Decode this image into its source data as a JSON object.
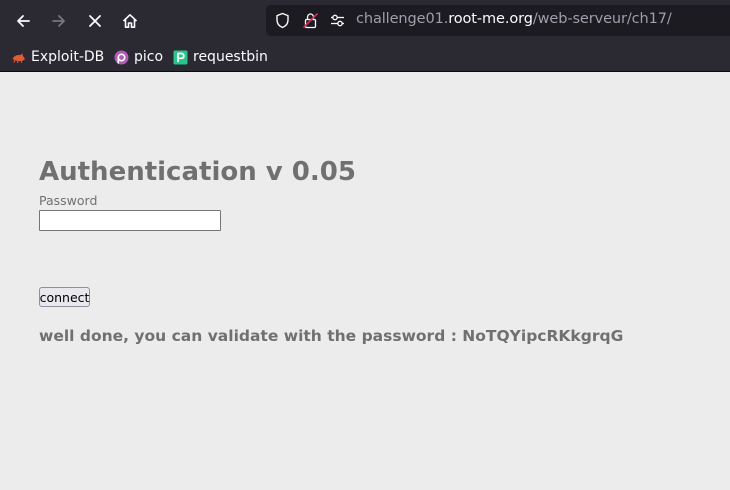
{
  "browser": {
    "url_prefix": "challenge01.",
    "url_domain": "root-me.org",
    "url_path": "/web-serveur/ch17/",
    "icons": [
      "back-arrow-icon",
      "forward-arrow-icon",
      "stop-icon",
      "home-icon",
      "shield-icon",
      "lock-warning-icon",
      "permissions-icon"
    ]
  },
  "bookmarks": [
    {
      "label": "Exploit-DB",
      "icon": "exploit-db-icon"
    },
    {
      "label": "pico",
      "icon": "pico-icon"
    },
    {
      "label": "requestbin",
      "icon": "requestbin-icon"
    }
  ],
  "page": {
    "title": "Authentication v 0.05",
    "password_label": "Password",
    "password_value": "",
    "connect_label": "connect",
    "message": "well done, you can validate with the password : NoTQYipcRKkgrqG"
  },
  "colors": {
    "chrome": "#2b2a33",
    "urlbar": "#1c1b22",
    "page_bg": "#ececec",
    "page_text": "#707070"
  }
}
